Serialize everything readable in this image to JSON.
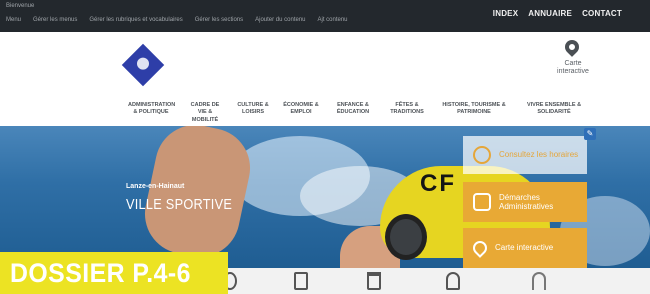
{
  "adminbar": {
    "items_row1": [
      "Bienvenue"
    ],
    "items_row2": [
      "Menu",
      "Gérer les menus",
      "Gérer les rubriques et vocabulaires",
      "Gérer les sections",
      "Ajouter du contenu",
      "Ajt contenu"
    ]
  },
  "topnav": [
    "INDEX",
    "ANNUAIRE",
    "CONTACT"
  ],
  "header": {
    "carte_label": "Carte interactive"
  },
  "mainnav": [
    "ADMINISTRATION & POLITIQUE",
    "CADRE DE VIE & MOBILITÉ",
    "CULTURE & LOISIRS",
    "ÉCONOMIE & EMPLOI",
    "ENFANCE & ÉDUCATION",
    "FÊTES & TRADITIONS",
    "HISTOIRE, TOURISME & PATRIMOINE",
    "VIVRE ENSEMBLE & SOLIDARITÉ"
  ],
  "hero": {
    "subtitle": "Lanze-en-Hainaut",
    "title": "VILLE SPORTIVE",
    "cap_text": "CF",
    "buttons": [
      {
        "label": "Consultez les horaires",
        "icon": "clock-icon"
      },
      {
        "label": "Démarches Administratives",
        "icon": "document-icon"
      },
      {
        "label": "Carte interactive",
        "icon": "map-pin-icon"
      }
    ]
  },
  "banner": {
    "text": "DOSSIER P.4-6"
  },
  "colors": {
    "accent_orange": "#e8a935",
    "banner_yellow": "#ece323",
    "admin_bar": "#23282d",
    "logo_blue": "#2e3ea8"
  }
}
